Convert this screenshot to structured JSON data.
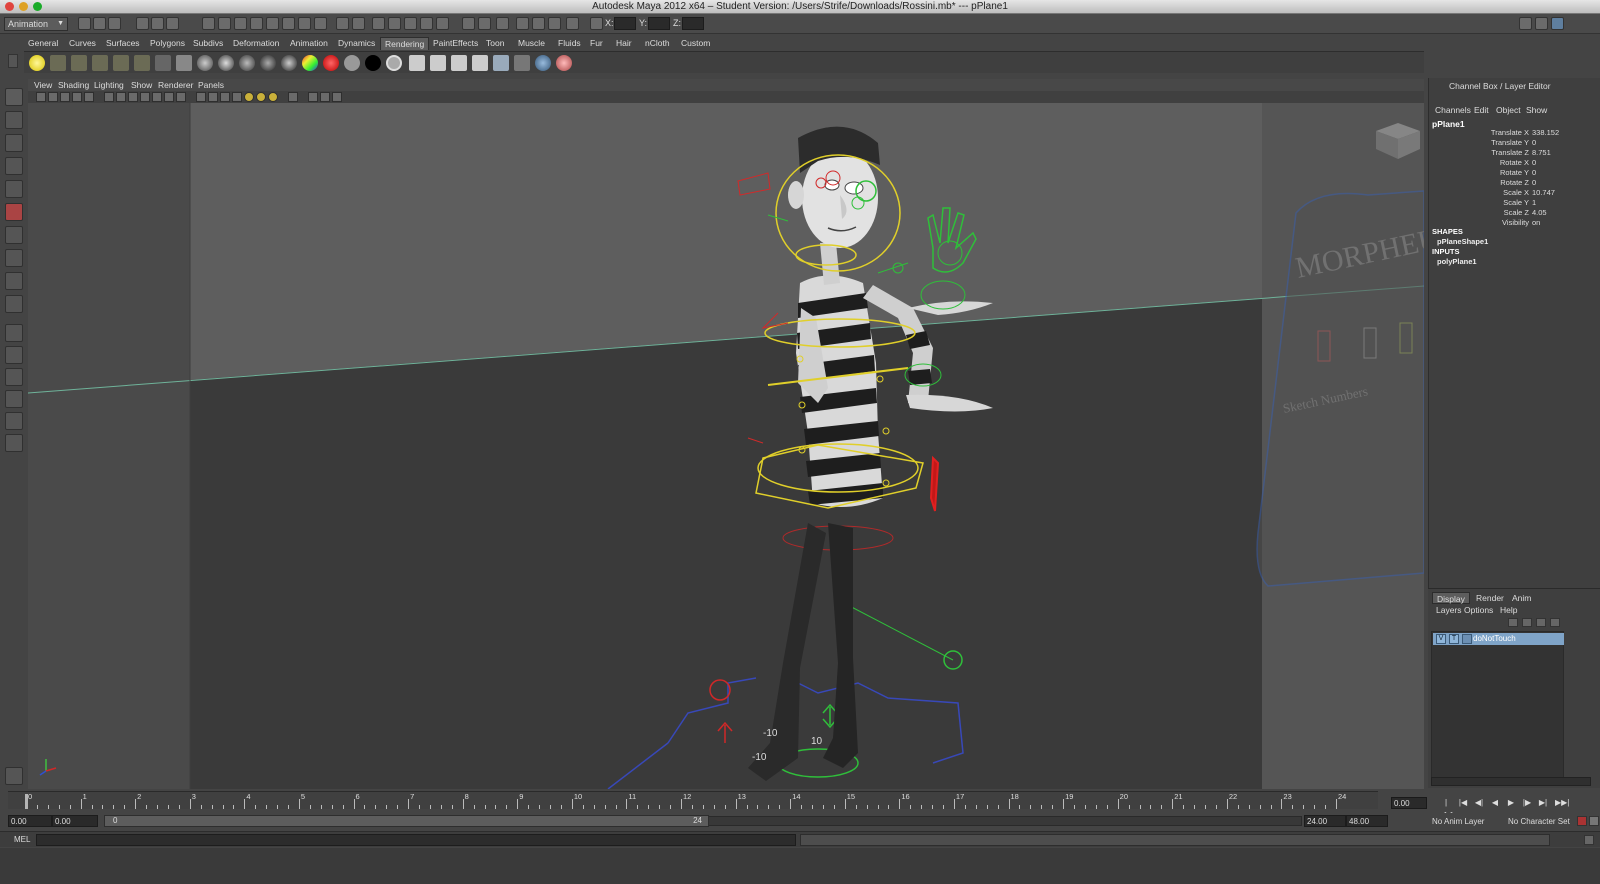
{
  "window": {
    "title": "Autodesk Maya 2012 x64 – Student Version: /Users/Strife/Downloads/Rossini.mb*   ---   pPlane1"
  },
  "statusline": {
    "mode": "Animation",
    "coord_x_label": "X:",
    "coord_y_label": "Y:",
    "coord_z_label": "Z:"
  },
  "shelf": {
    "tabs": [
      "General",
      "Curves",
      "Surfaces",
      "Polygons",
      "Subdivs",
      "Deformation",
      "Animation",
      "Dynamics",
      "Rendering",
      "PaintEffects",
      "Toon",
      "Muscle",
      "Fluids",
      "Fur",
      "Hair",
      "nCloth",
      "Custom"
    ],
    "active_tab": "Rendering"
  },
  "panel": {
    "menus": [
      "View",
      "Shading",
      "Lighting",
      "Show",
      "Renderer",
      "Panels"
    ]
  },
  "channel_box": {
    "title": "Channel Box / Layer Editor",
    "menus": [
      "Channels",
      "Edit",
      "Object",
      "Show"
    ],
    "object_name": "pPlane1",
    "attributes": [
      {
        "name": "Translate X",
        "value": "338.152"
      },
      {
        "name": "Translate Y",
        "value": "0"
      },
      {
        "name": "Translate Z",
        "value": "8.751"
      },
      {
        "name": "Rotate X",
        "value": "0"
      },
      {
        "name": "Rotate Y",
        "value": "0"
      },
      {
        "name": "Rotate Z",
        "value": "0"
      },
      {
        "name": "Scale X",
        "value": "10.747"
      },
      {
        "name": "Scale Y",
        "value": "1"
      },
      {
        "name": "Scale Z",
        "value": "4.05"
      },
      {
        "name": "Visibility",
        "value": "on"
      }
    ],
    "shapes_header": "SHAPES",
    "shape_name": "pPlaneShape1",
    "inputs_header": "INPUTS",
    "input_name": "polyPlane1"
  },
  "layer_editor": {
    "tabs": [
      "Display",
      "Render",
      "Anim"
    ],
    "active_tab": "Display",
    "menus": [
      "Layers",
      "Options",
      "Help"
    ],
    "layers": [
      {
        "v": "V",
        "t": "T",
        "name": "doNotTouch"
      }
    ]
  },
  "timeline": {
    "tick_labels": [
      "0",
      "1",
      "2",
      "3",
      "4",
      "5",
      "6",
      "7",
      "8",
      "9",
      "10",
      "11",
      "12",
      "13",
      "14",
      "15",
      "16",
      "17",
      "18",
      "19",
      "20",
      "21",
      "22",
      "23",
      "24"
    ],
    "current_frame": "0.00"
  },
  "range": {
    "start_time": "0.00",
    "playback_start": "0.00",
    "handle_start": "0",
    "handle_end": "24",
    "playback_end": "24.00",
    "end_time": "48.00",
    "anim_layer": "No Anim Layer",
    "character_set": "No Character Set"
  },
  "command_line": {
    "label": "MEL"
  },
  "viewport": {
    "grid_labels": [
      "-10",
      "10",
      "-10"
    ]
  }
}
